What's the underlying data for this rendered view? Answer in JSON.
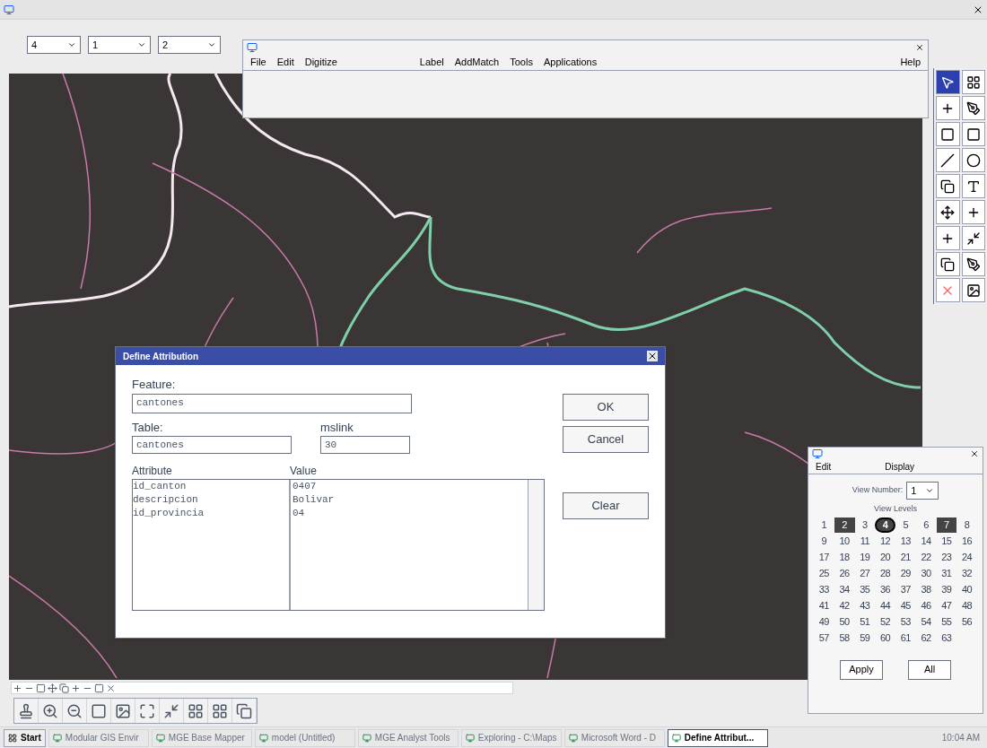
{
  "main_window": {
    "level_combo": "4",
    "style_combo": "1",
    "weight_combo": "2"
  },
  "command_window": {
    "menu": [
      "File",
      "Edit",
      "Digitize",
      "Label",
      "AddMatch",
      "Tools",
      "Applications",
      "Help"
    ]
  },
  "dialog": {
    "title": "Define Attribution",
    "feature_label": "Feature:",
    "feature_value": "cantones",
    "table_label": "Table:",
    "table_value": "cantones",
    "mslink_label": "mslink",
    "mslink_value": "30",
    "columns": [
      "Attribute",
      "Value"
    ],
    "rows": [
      {
        "attribute": "id_canton",
        "value": "0407"
      },
      {
        "attribute": "descripcion",
        "value": "Bolivar"
      },
      {
        "attribute": "id_provincia",
        "value": "04"
      }
    ],
    "buttons": [
      "OK",
      "Cancel",
      "Clear"
    ]
  },
  "levels_window": {
    "menu": [
      "Edit",
      "Display"
    ],
    "view_number_label": "View Number:",
    "view_number": "1",
    "levels_label": "View Levels",
    "levels": [
      {
        "label": "1",
        "on": false,
        "active": false
      },
      {
        "label": "2",
        "on": true,
        "active": false
      },
      {
        "label": "3",
        "on": false,
        "active": false
      },
      {
        "label": "4",
        "on": true,
        "active": true
      },
      {
        "label": "5",
        "on": false,
        "active": false
      },
      {
        "label": "6",
        "on": false,
        "active": false
      },
      {
        "label": "7",
        "on": true,
        "active": false
      },
      {
        "label": "8",
        "on": false,
        "active": false
      },
      {
        "label": "9",
        "on": false,
        "active": false
      },
      {
        "label": "10",
        "on": false,
        "active": false
      },
      {
        "label": "11",
        "on": false,
        "active": false
      },
      {
        "label": "12",
        "on": false,
        "active": false
      },
      {
        "label": "13",
        "on": false,
        "active": false
      },
      {
        "label": "14",
        "on": false,
        "active": false
      },
      {
        "label": "15",
        "on": false,
        "active": false
      },
      {
        "label": "16",
        "on": false,
        "active": false
      },
      {
        "label": "17",
        "on": false,
        "active": false
      },
      {
        "label": "18",
        "on": false,
        "active": false
      },
      {
        "label": "19",
        "on": false,
        "active": false
      },
      {
        "label": "20",
        "on": false,
        "active": false
      },
      {
        "label": "21",
        "on": false,
        "active": false
      },
      {
        "label": "22",
        "on": false,
        "active": false
      },
      {
        "label": "23",
        "on": false,
        "active": false
      },
      {
        "label": "24",
        "on": false,
        "active": false
      },
      {
        "label": "25",
        "on": false,
        "active": false
      },
      {
        "label": "26",
        "on": false,
        "active": false
      },
      {
        "label": "27",
        "on": false,
        "active": false
      },
      {
        "label": "28",
        "on": false,
        "active": false
      },
      {
        "label": "29",
        "on": false,
        "active": false
      },
      {
        "label": "30",
        "on": false,
        "active": false
      },
      {
        "label": "31",
        "on": false,
        "active": false
      },
      {
        "label": "32",
        "on": false,
        "active": false
      },
      {
        "label": "33",
        "on": false,
        "active": false
      },
      {
        "label": "34",
        "on": false,
        "active": false
      },
      {
        "label": "35",
        "on": false,
        "active": false
      },
      {
        "label": "36",
        "on": false,
        "active": false
      },
      {
        "label": "37",
        "on": false,
        "active": false
      },
      {
        "label": "38",
        "on": false,
        "active": false
      },
      {
        "label": "39",
        "on": false,
        "active": false
      },
      {
        "label": "40",
        "on": false,
        "active": false
      },
      {
        "label": "41",
        "on": false,
        "active": false
      },
      {
        "label": "42",
        "on": false,
        "active": false
      },
      {
        "label": "43",
        "on": false,
        "active": false
      },
      {
        "label": "44",
        "on": false,
        "active": false
      },
      {
        "label": "45",
        "on": false,
        "active": false
      },
      {
        "label": "46",
        "on": false,
        "active": false
      },
      {
        "label": "47",
        "on": false,
        "active": false
      },
      {
        "label": "48",
        "on": false,
        "active": false
      },
      {
        "label": "49",
        "on": false,
        "active": false
      },
      {
        "label": "50",
        "on": false,
        "active": false
      },
      {
        "label": "51",
        "on": false,
        "active": false
      },
      {
        "label": "52",
        "on": false,
        "active": false
      },
      {
        "label": "53",
        "on": false,
        "active": false
      },
      {
        "label": "54",
        "on": false,
        "active": false
      },
      {
        "label": "55",
        "on": false,
        "active": false
      },
      {
        "label": "56",
        "on": false,
        "active": false
      },
      {
        "label": "57",
        "on": false,
        "active": false
      },
      {
        "label": "58",
        "on": false,
        "active": false
      },
      {
        "label": "59",
        "on": false,
        "active": false
      },
      {
        "label": "60",
        "on": false,
        "active": false
      },
      {
        "label": "61",
        "on": false,
        "active": false
      },
      {
        "label": "62",
        "on": false,
        "active": false
      },
      {
        "label": "63",
        "on": false,
        "active": false
      }
    ],
    "buttons": [
      "Apply",
      "All"
    ]
  },
  "taskbar": {
    "start": "Start",
    "items": [
      {
        "label": "Modular GIS Envir",
        "selected": false
      },
      {
        "label": "MGE Base Mapper",
        "selected": false
      },
      {
        "label": "model (Untitled)",
        "selected": false
      },
      {
        "label": "MGE Analyst Tools",
        "selected": false
      },
      {
        "label": "Exploring - C:\\Maps",
        "selected": false
      },
      {
        "label": "Microsoft Word - D",
        "selected": false
      },
      {
        "label": "Define Attribut...",
        "selected": true
      }
    ],
    "clock": "10:04 AM"
  }
}
